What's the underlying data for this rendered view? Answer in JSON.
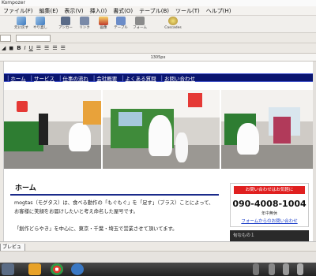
{
  "window": {
    "title": "Kompozer"
  },
  "menu": {
    "items": [
      "ファイル(F)",
      "編集(E)",
      "表示(V)",
      "挿入(I)",
      "書式(O)",
      "テーブル(B)",
      "ツール(T)",
      "ヘルプ(H)"
    ]
  },
  "toolbar": {
    "buttons": [
      "元に戻す",
      "やり直し",
      "アンカー",
      "リンク",
      "画像",
      "テーブル",
      "フォーム",
      "Cascades"
    ]
  },
  "format": {
    "buttons": [
      "B",
      "I",
      "U"
    ]
  },
  "ruler": {
    "width_label": "1305px"
  },
  "site": {
    "nav": [
      "ホーム",
      "サービス",
      "仕事の流れ",
      "会社概要",
      "よくある質問",
      "お問い合わせ"
    ],
    "section_title": "ホーム",
    "paragraph1": "mogtas（モグタス）は、食べる動作の「もぐもぐ」を「足す」（プラス）ことによって、",
    "paragraph2": "お客様に笑顔をお届けしたいと考え命名した屋号です。",
    "paragraph3": "「創作どらやき」を中心に、東京・千葉・埼玉で営業させて頂いてます。",
    "contact": {
      "header": "お問い合わせはお気軽に",
      "phone": "090-4008-1004",
      "sub": "年中無休",
      "link": "フォームからのお問い合わせ"
    },
    "side_box": "旬なもの１"
  },
  "bottom": {
    "preview_tab": "プレビュー"
  },
  "colors": {
    "nav_bg": "#0a1570",
    "accent": "#e02020",
    "link": "#1a3cc8"
  }
}
